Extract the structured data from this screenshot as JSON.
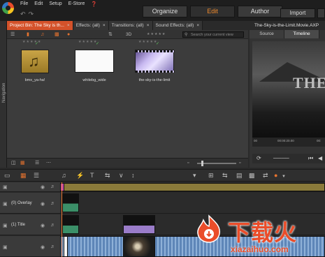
{
  "menu": {
    "items": [
      "File",
      "Edit",
      "Setup",
      "E-Store"
    ],
    "help_icon": "help-icon"
  },
  "modes": {
    "organize": "Organize",
    "edit": "Edit",
    "author": "Author",
    "import": "Import"
  },
  "library": {
    "tabs": [
      {
        "label": "Project Bin: The Sky is th...",
        "close": "×"
      },
      {
        "label": "Effects: (all)",
        "close": "×"
      },
      {
        "label": "Transitions: (all)",
        "close": "×"
      },
      {
        "label": "Sound Effects: (all)",
        "close": "×"
      }
    ],
    "search_placeholder": "Search your current view",
    "toolbar_3d": "3D",
    "navigation_label": "Navigation",
    "clips": [
      {
        "label": "bmx_ya-ha!",
        "type": "music-icon"
      },
      {
        "label": "whitebg_wide",
        "type": "image"
      },
      {
        "label": "the-sky-is-the-limit",
        "type": "video"
      }
    ]
  },
  "player": {
    "title": "The-Sky-is-the-Limit.Movie.AXP",
    "tabs": [
      "Source",
      "Timeline"
    ],
    "active_tab": "Timeline",
    "preview_text": "THE",
    "timecodes": [
      "00",
      "00:00:20.00",
      "00:"
    ]
  },
  "timeline": {
    "tracks": [
      {
        "name": ""
      },
      {
        "name": "(0) Overlay"
      },
      {
        "name": "(1) Title"
      },
      {
        "name": ""
      }
    ]
  },
  "watermark": {
    "chinese": "下载火",
    "site": "xiazaihuo.com"
  },
  "colors": {
    "accent": "#f08a2c",
    "active_tab": "#d4522a",
    "watermark": "#ea4d2a"
  }
}
